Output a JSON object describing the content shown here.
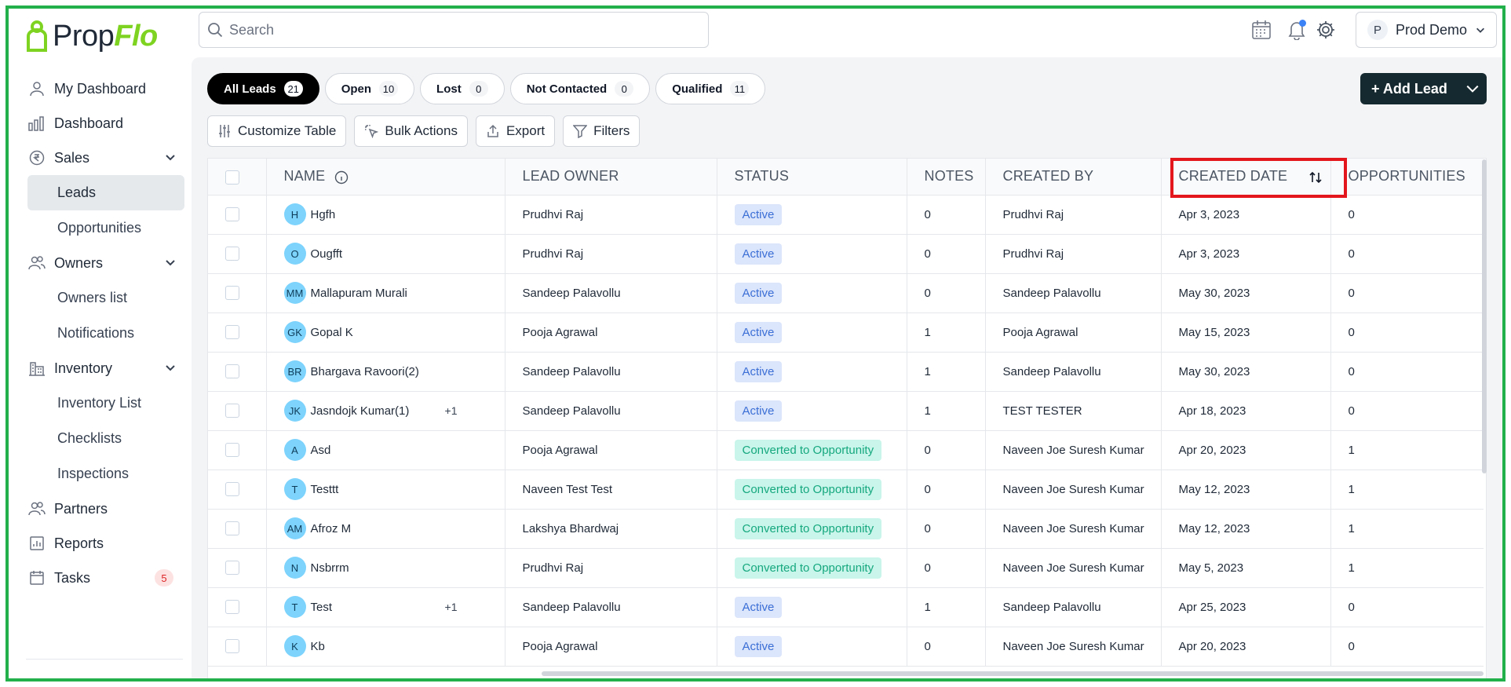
{
  "app": {
    "logo_text_prop": "Prop",
    "logo_text_flo": "Flo"
  },
  "sidebar": {
    "items": [
      {
        "label": "My Dashboard"
      },
      {
        "label": "Dashboard"
      },
      {
        "label": "Sales"
      },
      {
        "label": "Leads"
      },
      {
        "label": "Opportunities"
      },
      {
        "label": "Owners"
      },
      {
        "label": "Owners list"
      },
      {
        "label": "Notifications"
      },
      {
        "label": "Inventory"
      },
      {
        "label": "Inventory List"
      },
      {
        "label": "Checklists"
      },
      {
        "label": "Inspections"
      },
      {
        "label": "Partners"
      },
      {
        "label": "Reports"
      },
      {
        "label": "Tasks",
        "badge": "5"
      }
    ]
  },
  "topbar": {
    "search_placeholder": "Search",
    "user_initial": "P",
    "user_name": "Prod Demo"
  },
  "tabs": [
    {
      "label": "All Leads",
      "count": "21"
    },
    {
      "label": "Open",
      "count": "10"
    },
    {
      "label": "Lost",
      "count": "0"
    },
    {
      "label": "Not Contacted",
      "count": "0"
    },
    {
      "label": "Qualified",
      "count": "11"
    }
  ],
  "actions": {
    "add_lead": "+ Add Lead"
  },
  "toolbar": {
    "customize": "Customize Table",
    "bulk": "Bulk Actions",
    "export": "Export",
    "filters": "Filters"
  },
  "table": {
    "columns": {
      "name": "NAME",
      "lead_owner": "LEAD OWNER",
      "status": "STATUS",
      "notes": "NOTES",
      "created_by": "CREATED BY",
      "created_date": "CREATED DATE",
      "opportunities": "OPPORTUNITIES"
    },
    "rows": [
      {
        "initials": "H",
        "name": "Hgfh",
        "extra": "",
        "owner": "Prudhvi Raj",
        "status": "Active",
        "notes": "0",
        "created_by": "Prudhvi Raj",
        "created_date": "Apr 3, 2023",
        "opps": "0"
      },
      {
        "initials": "O",
        "name": "Ougfft",
        "extra": "",
        "owner": "Prudhvi Raj",
        "status": "Active",
        "notes": "0",
        "created_by": "Prudhvi Raj",
        "created_date": "Apr 3, 2023",
        "opps": "0"
      },
      {
        "initials": "MM",
        "name": "Mallapuram Murali",
        "extra": "",
        "owner": "Sandeep Palavollu",
        "status": "Active",
        "notes": "0",
        "created_by": "Sandeep Palavollu",
        "created_date": "May 30, 2023",
        "opps": "0"
      },
      {
        "initials": "GK",
        "name": "Gopal K",
        "extra": "",
        "owner": "Pooja Agrawal",
        "status": "Active",
        "notes": "1",
        "created_by": "Pooja Agrawal",
        "created_date": "May 15, 2023",
        "opps": "0"
      },
      {
        "initials": "BR",
        "name": "Bhargava Ravoori(2)",
        "extra": "",
        "owner": "Sandeep Palavollu",
        "status": "Active",
        "notes": "1",
        "created_by": "Sandeep Palavollu",
        "created_date": "May 30, 2023",
        "opps": "0"
      },
      {
        "initials": "JK",
        "name": "Jasndojk Kumar(1)",
        "extra": "+1",
        "owner": "Sandeep Palavollu",
        "status": "Active",
        "notes": "1",
        "created_by": "TEST TESTER",
        "created_date": "Apr 18, 2023",
        "opps": "0"
      },
      {
        "initials": "A",
        "name": "Asd",
        "extra": "",
        "owner": "Pooja Agrawal",
        "status": "Converted to Opportunity",
        "notes": "0",
        "created_by": "Naveen Joe Suresh Kumar",
        "created_date": "Apr 20, 2023",
        "opps": "1"
      },
      {
        "initials": "T",
        "name": "Testtt",
        "extra": "",
        "owner": "Naveen Test Test",
        "status": "Converted to Opportunity",
        "notes": "0",
        "created_by": "Naveen Joe Suresh Kumar",
        "created_date": "May 12, 2023",
        "opps": "1"
      },
      {
        "initials": "AM",
        "name": "Afroz M",
        "extra": "",
        "owner": "Lakshya Bhardwaj",
        "status": "Converted to Opportunity",
        "notes": "0",
        "created_by": "Naveen Joe Suresh Kumar",
        "created_date": "May 12, 2023",
        "opps": "1"
      },
      {
        "initials": "N",
        "name": "Nsbrrm",
        "extra": "",
        "owner": "Prudhvi Raj",
        "status": "Converted to Opportunity",
        "notes": "0",
        "created_by": "Naveen Joe Suresh Kumar",
        "created_date": "May 5, 2023",
        "opps": "1"
      },
      {
        "initials": "T",
        "name": "Test",
        "extra": "+1",
        "owner": "Sandeep Palavollu",
        "status": "Active",
        "notes": "1",
        "created_by": "Sandeep Palavollu",
        "created_date": "Apr 25, 2023",
        "opps": "0"
      },
      {
        "initials": "K",
        "name": "Kb",
        "extra": "",
        "owner": "Pooja Agrawal",
        "status": "Active",
        "notes": "0",
        "created_by": "Naveen Joe Suresh Kumar",
        "created_date": "Apr 20, 2023",
        "opps": "0"
      }
    ]
  },
  "colors": {
    "brand_green": "#7ed321",
    "frame_green": "#22b04b",
    "highlight_red": "#e3161c",
    "add_lead_bg": "#152a30",
    "status_active_bg": "#dbe5fb",
    "status_converted_bg": "#c9f5ea"
  }
}
